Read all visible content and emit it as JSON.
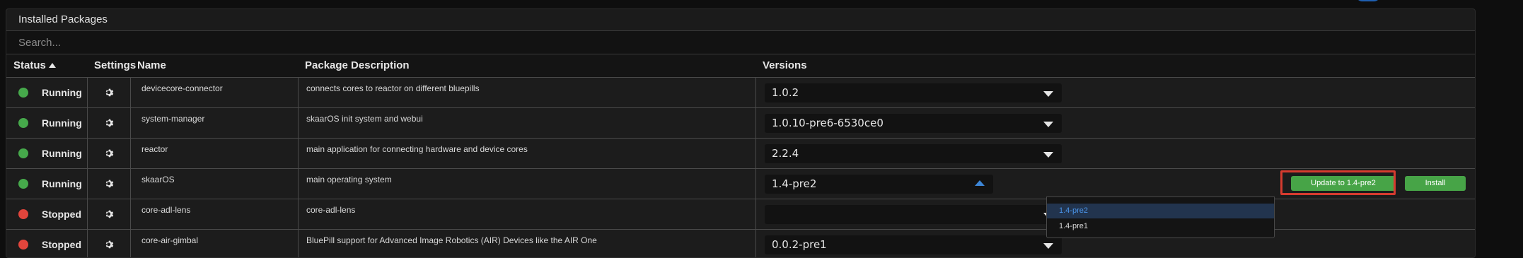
{
  "panel": {
    "title": "Installed Packages"
  },
  "search": {
    "placeholder": "Search..."
  },
  "columns": {
    "status": "Status",
    "settings": "Settings",
    "name": "Name",
    "description": "Package Description",
    "versions": "Versions"
  },
  "status_colors": {
    "Running": "#46a94b",
    "Stopped": "#e2453c"
  },
  "rows": [
    {
      "status": "Running",
      "name": "devicecore-connector",
      "description": "connects cores to reactor on different bluepills",
      "version": "1.0.2"
    },
    {
      "status": "Running",
      "name": "system-manager",
      "description": "skaarOS init system and webui",
      "version": "1.0.10-pre6-6530ce0"
    },
    {
      "status": "Running",
      "name": "reactor",
      "description": "main application for connecting hardware and device cores",
      "version": "2.2.4"
    },
    {
      "status": "Running",
      "name": "skaarOS",
      "description": "main operating system",
      "version": "1.4-pre2"
    },
    {
      "status": "Stopped",
      "name": "core-adl-lens",
      "description": "core-adl-lens",
      "version": ""
    },
    {
      "status": "Stopped",
      "name": "core-air-gimbal",
      "description": "BluePill support for Advanced Image Robotics (AIR) Devices like the AIR One",
      "version": "0.0.2-pre1"
    }
  ],
  "actions": {
    "update_label": "Update to 1.4-pre2",
    "install_label": "Install"
  },
  "dropdown": {
    "options": [
      "1.4-pre2",
      "1.4-pre1"
    ],
    "selected": "1.4-pre2"
  },
  "colors": {
    "accent_green": "#47a447",
    "highlight_red": "#d63b2f",
    "dropdown_active": "#4a94e8"
  }
}
